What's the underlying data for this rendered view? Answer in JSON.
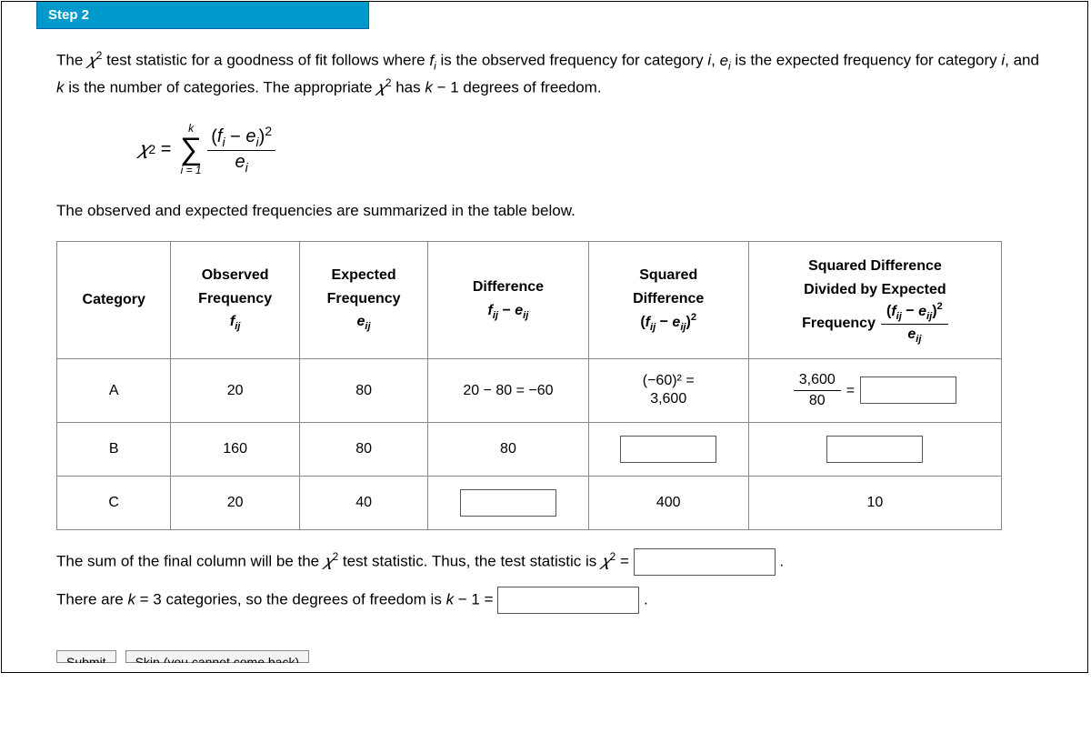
{
  "step_label": "Step 2",
  "intro_part1": "The ",
  "intro_part2": " test statistic for a goodness of fit follows where ",
  "intro_part3": " is the observed frequency for category ",
  "intro_part4": " is the expected frequency for category ",
  "intro_part5": ", and ",
  "intro_part6": " is the number of categories. The appropriate ",
  "intro_part7": " has ",
  "intro_part8": " − 1 degrees of freedom.",
  "table_intro": "The observed and expected frequencies are summarized in the table below.",
  "headers": {
    "category": "Category",
    "observed_line1": "Observed",
    "observed_line2": "Frequency",
    "expected_line1": "Expected",
    "expected_line2": "Frequency",
    "difference": "Difference",
    "squared_line1": "Squared",
    "squared_line2": "Difference",
    "divided_line1": "Squared Difference",
    "divided_line2": "Divided by Expected",
    "divided_line3": "Frequency"
  },
  "rows": {
    "a": {
      "cat": "A",
      "obs": "20",
      "exp": "80",
      "diff": "20 − 80 = −60",
      "sq_num": "(−60)² =",
      "sq_res": "3,600",
      "div_num": "3,600",
      "div_den": "80"
    },
    "b": {
      "cat": "B",
      "obs": "160",
      "exp": "80",
      "diff": "80"
    },
    "c": {
      "cat": "C",
      "obs": "20",
      "exp": "40",
      "sq": "400",
      "div": "10"
    }
  },
  "sum_text_1": "The sum of the final column will be the ",
  "sum_text_2": " test statistic. Thus, the test statistic is ",
  "df_text_1": "There are ",
  "df_text_2": " = 3 categories, so the degrees of freedom is ",
  "df_text_3": " − 1 = ",
  "submit_label": "Submit",
  "skip_label": "Skip (you cannot come back)"
}
